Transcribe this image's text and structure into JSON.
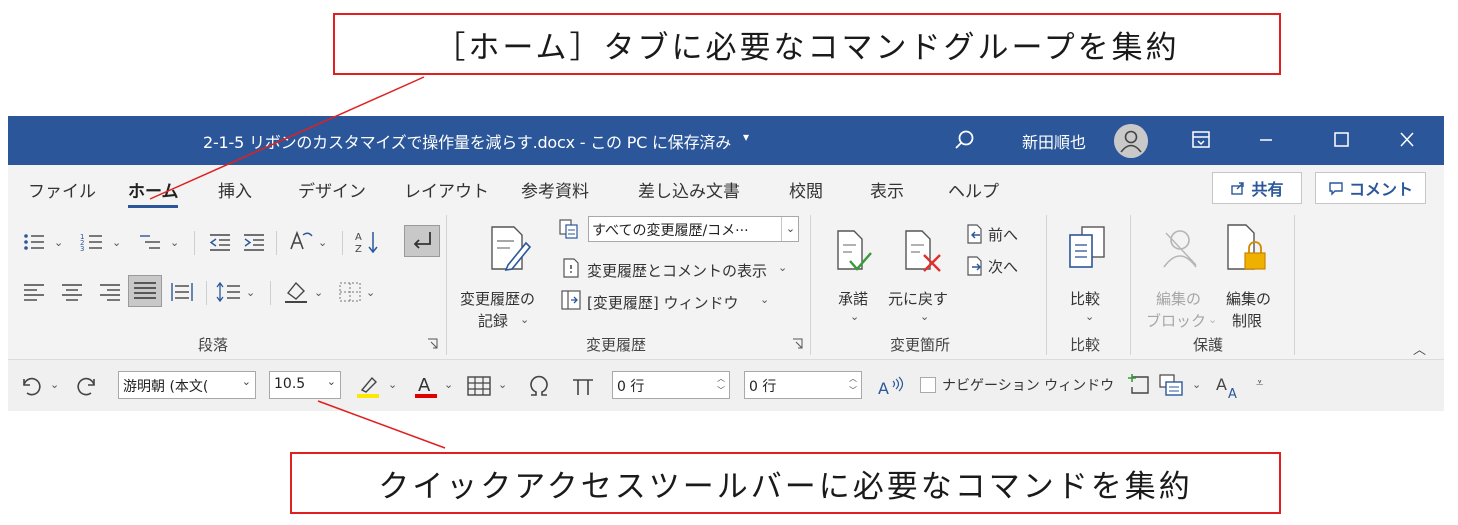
{
  "callouts": {
    "top": "［ホーム］タブに必要なコマンドグループを集約",
    "bottom": "クイックアクセスツールバーに必要なコマンドを集約",
    "line_color": "#e0201f"
  },
  "titlebar": {
    "title": "2-1-5 リボンのカスタマイズで操作量を減らす.docx - この PC に保存済み",
    "title_caret": "▾",
    "user_name": "新田順也",
    "bg_color": "#2b579a"
  },
  "tabs": {
    "file": "ファイル",
    "home": "ホーム",
    "insert": "挿入",
    "design": "デザイン",
    "layout": "レイアウト",
    "references": "参考資料",
    "mailings": "差し込み文書",
    "review": "校閲",
    "view": "表示",
    "help": "ヘルプ",
    "share": "共有",
    "comment": "コメント"
  },
  "ribbon": {
    "paragraph_group": "段落",
    "tracking_group": "変更履歴",
    "changes_group": "変更箇所",
    "compare_group": "比較",
    "protect_group": "保護",
    "track_changes_line1": "変更履歴の",
    "track_changes_line2": "記録",
    "track_select_value": "すべての変更履歴/コメ···",
    "show_markup": "変更履歴とコメントの表示",
    "reviewing_pane": "[変更履歴] ウィンドウ",
    "accept": "承諾",
    "reject": "元に戻す",
    "previous": "前へ",
    "next": "次へ",
    "compare": "比較",
    "block_authors_line1": "編集の",
    "block_authors_line2": "ブロック",
    "restrict_editing_line1": "編集の",
    "restrict_editing_line2": "制限"
  },
  "qat": {
    "font_name": "游明朝 (本文(",
    "font_size": "10.5",
    "line_spacing_before": "0 行",
    "line_spacing_after": "0 行",
    "navigation_pane": "ナビゲーション ウィンドウ",
    "highlight_color": "#ffe800",
    "font_color": "#e00000"
  }
}
